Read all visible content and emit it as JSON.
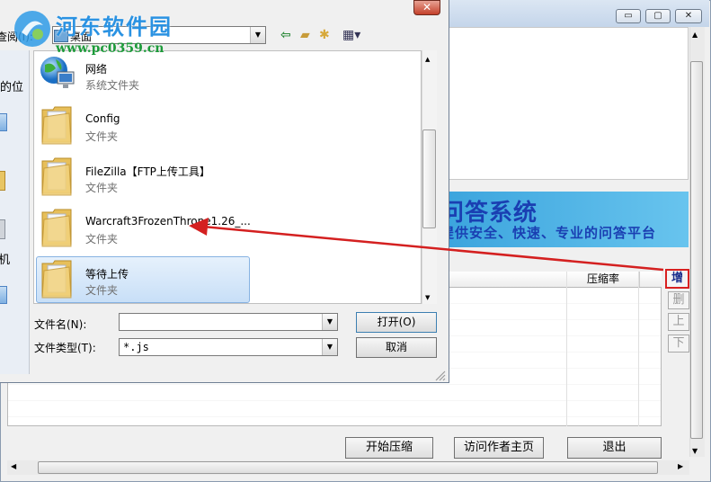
{
  "watermark": {
    "title": "河东软件园",
    "url": "www.pc0359.cn"
  },
  "main_window": {
    "banner_title": "问答系统",
    "banner_subtitle": "提供安全、快速、专业的问答平台",
    "list_column": "压缩率",
    "side_buttons": {
      "add": "增",
      "delete": "删",
      "up": "上",
      "down": "下"
    },
    "bottom_buttons": {
      "start": "开始压缩",
      "visit": "访问作者主页",
      "exit": "退出"
    },
    "title_buttons": {
      "minimize": "▭",
      "maximize": "▢",
      "close": "✕"
    }
  },
  "dialog": {
    "close_label": "✕",
    "lookin_label": "查阅(I):",
    "lookin_value": "桌面",
    "places": [
      "的位",
      "机"
    ],
    "items": [
      {
        "name": "网络",
        "type": "系统文件夹"
      },
      {
        "name": "Config",
        "type": "文件夹"
      },
      {
        "name": "FileZilla【FTP上传工具】",
        "type": "文件夹"
      },
      {
        "name": "Warcraft3FrozenThrone1.26_...",
        "type": "文件夹"
      },
      {
        "name": "等待上传",
        "type": "文件夹"
      }
    ],
    "filename_label": "文件名(N):",
    "filename_value": "",
    "filetype_label": "文件类型(T):",
    "filetype_value": "*.js",
    "open_button": "打开(O)",
    "cancel_button": "取消"
  }
}
